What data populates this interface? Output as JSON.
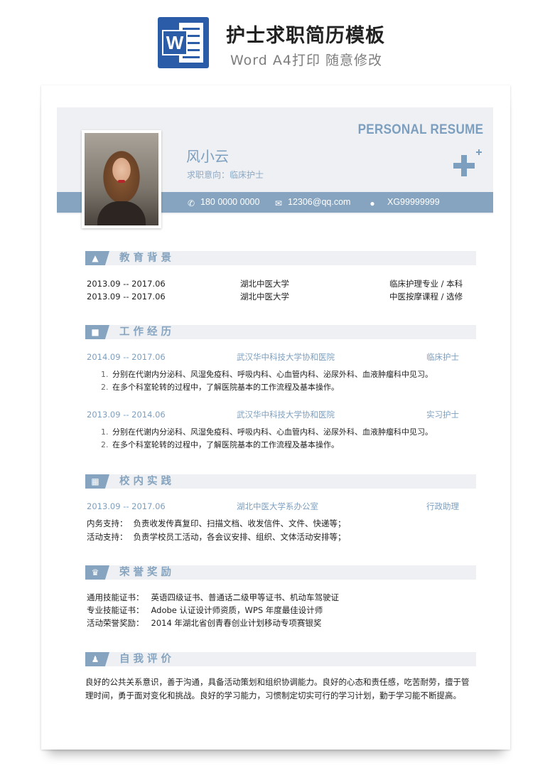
{
  "banner": {
    "logo_letter": "W",
    "title": "护士求职简历模板",
    "subtitle": "Word A4打印 随意修改"
  },
  "header": {
    "resume_label": "PERSONAL RESUME",
    "name": "风小云",
    "intent": "求职意向：临床护士",
    "phone": "180 0000 0000",
    "email": "12306@qq.com",
    "wechat": "XG99999999"
  },
  "education": {
    "title": "教育背景",
    "rows": [
      {
        "period": "2013.09 -- 2017.06",
        "school": "湖北中医大学",
        "major": "临床护理专业 / 本科"
      },
      {
        "period": "2013.09 -- 2017.06",
        "school": "湖北中医大学",
        "major": "中医按摩课程 / 选修"
      }
    ]
  },
  "work": {
    "title": "工作经历",
    "jobs": [
      {
        "period": "2014.09 -- 2017.06",
        "org": "武汉华中科技大学协和医院",
        "role": "临床护士",
        "items": [
          {
            "num": "1.",
            "text": "分别在代谢内分泌科、风湿免疫科、呼吸内科、心血管内科、泌尿外科、血液肿瘤科中见习。"
          },
          {
            "num": "2.",
            "text": "在多个科室轮转的过程中，了解医院基本的工作流程及基本操作。"
          }
        ]
      },
      {
        "period": "2013.09 -- 2014.06",
        "org": "武汉华中科技大学协和医院",
        "role": "实习护士",
        "items": [
          {
            "num": "1.",
            "text": "分别在代谢内分泌科、风湿免疫科、呼吸内科、心血管内科、泌尿外科、血液肿瘤科中见习。"
          },
          {
            "num": "2.",
            "text": "在多个科室轮转的过程中，了解医院基本的工作流程及基本操作。"
          }
        ]
      }
    ]
  },
  "campus": {
    "title": "校内实践",
    "period": "2013.09 -- 2017.06",
    "org": "湖北中医大学系办公室",
    "role": "行政助理",
    "lines": [
      {
        "label": "内务支持：",
        "text": "负责收发传真复印、扫描文档、收发信件、文件、快递等；"
      },
      {
        "label": "活动支持：",
        "text": "负责学校员工活动，各会议安排、组织、文体活动安排等；"
      }
    ]
  },
  "honors": {
    "title": "荣誉奖励",
    "lines": [
      {
        "label": "通用技能证书：",
        "text": "英语四级证书、普通话二级甲等证书、机动车驾驶证"
      },
      {
        "label": "专业技能证书：",
        "text": "Adobe 认证设计师资质，WPS 年度最佳设计师"
      },
      {
        "label": "活动荣誉奖励：",
        "text": "2014 年湖北省创青春创业计划移动专项赛银奖"
      }
    ]
  },
  "self": {
    "title": "自我评价",
    "text": "良好的公共关系意识，善于沟通，具备活动策划和组织协调能力。良好的心态和责任感，吃苦耐劳，擅于管理时间，勇于面对变化和挑战。良好的学习能力，习惯制定切实可行的学习计划，勤于学习能不断提高。"
  },
  "icons": {
    "phone": "phone-icon",
    "email": "email-icon",
    "wechat": "wechat-icon",
    "education": "graduation-cap-icon",
    "work": "briefcase-icon",
    "campus": "windows-grid-icon",
    "honors": "trophy-icon",
    "self": "person-icon"
  },
  "colors": {
    "accent": "#86a4bf",
    "accent_text": "#7d9fbf",
    "panel": "#eef0f3",
    "word_blue": "#2b5ca8"
  }
}
